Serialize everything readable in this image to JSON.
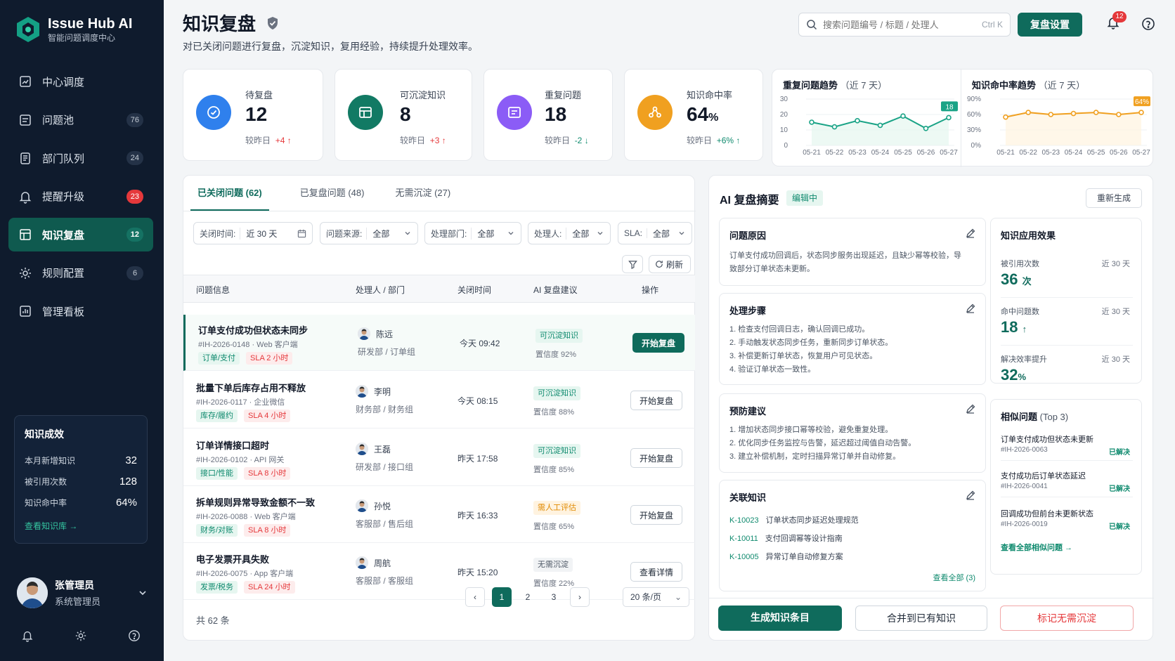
{
  "app": {
    "name": "Issue Hub AI",
    "subtitle": "智能问题调度中心"
  },
  "sidebar": {
    "items": [
      {
        "label": "中心调度",
        "badge": ""
      },
      {
        "label": "问题池",
        "badge": "76"
      },
      {
        "label": "部门队列",
        "badge": "24"
      },
      {
        "label": "提醒升级",
        "badge": "23"
      },
      {
        "label": "知识复盘",
        "badge": "12"
      },
      {
        "label": "规则配置",
        "badge": "6"
      },
      {
        "label": "管理看板",
        "badge": ""
      }
    ],
    "stats": {
      "title": "知识成效",
      "rows": [
        {
          "label": "本月新增知识",
          "value": "32"
        },
        {
          "label": "被引用次数",
          "value": "128"
        },
        {
          "label": "知识命中率",
          "value": "64%"
        }
      ],
      "link": "查看知识库 →"
    },
    "user": {
      "name": "张管理员",
      "role": "系统管理员"
    }
  },
  "header": {
    "title": "知识复盘",
    "desc": "对已关闭问题进行复盘，沉淀知识，复用经验，持续提升处理效率。",
    "search_placeholder": "搜索问题编号 / 标题 / 处理人",
    "search_kbd": "Ctrl K",
    "settings_btn": "复盘设置",
    "notif_count": "12"
  },
  "kpis": [
    {
      "label": "待复盘",
      "value": "12",
      "unit": "",
      "delta_label": "较昨日",
      "delta": "+4 ↑"
    },
    {
      "label": "可沉淀知识",
      "value": "8",
      "unit": "",
      "delta_label": "较昨日",
      "delta": "+3 ↑"
    },
    {
      "label": "重复问题",
      "value": "18",
      "unit": "",
      "delta_label": "较昨日",
      "delta": "-2 ↓"
    },
    {
      "label": "知识命中率",
      "value": "64",
      "unit": "%",
      "delta_label": "较昨日",
      "delta": "+6% ↑"
    }
  ],
  "colors": {
    "primary": "#0f6b5c",
    "sidebar": "#0f1b2d",
    "danger": "#e5383b",
    "teal": "#1aa386",
    "orange": "#f0a020",
    "blue": "#2f80ed",
    "purple": "#8b5cf6"
  },
  "chart_data": [
    {
      "type": "line",
      "title": "重复问题趋势",
      "subtitle": "（近 7 天）",
      "x": [
        "05-21",
        "05-22",
        "05-23",
        "05-24",
        "05-25",
        "05-26",
        "05-27"
      ],
      "series": [
        {
          "values": [
            15,
            12,
            16,
            13,
            19,
            11,
            18
          ]
        }
      ],
      "yticks": [
        "30",
        "20",
        "10",
        "0"
      ],
      "ylim": [
        0,
        30
      ],
      "last_label": "18"
    },
    {
      "type": "line",
      "title": "知识命中率趋势",
      "subtitle": "（近 7 天）",
      "x": [
        "05-21",
        "05-22",
        "05-23",
        "05-24",
        "05-25",
        "05-26",
        "05-27"
      ],
      "series": [
        {
          "values": [
            55,
            64,
            60,
            62,
            64,
            60,
            64
          ]
        }
      ],
      "yticks": [
        "90%",
        "60%",
        "30%",
        "0%"
      ],
      "ylim": [
        0,
        90
      ],
      "last_label": "64%"
    }
  ],
  "table": {
    "tabs": [
      "已关闭问题 (62)",
      "已复盘问题 (48)",
      "无需沉淀 (27)"
    ],
    "filters": [
      {
        "label": "关闭时间:",
        "value": "近 30 天"
      },
      {
        "label": "问题来源:",
        "value": "全部"
      },
      {
        "label": "处理部门:",
        "value": "全部"
      },
      {
        "label": "处理人:",
        "value": "全部"
      },
      {
        "label": "SLA:",
        "value": "全部"
      }
    ],
    "refresh": "刷新",
    "columns": [
      "问题信息",
      "处理人 / 部门",
      "关闭时间",
      "AI 复盘建议",
      "操作"
    ],
    "rows": [
      {
        "title": "订单支付成功但状态未同步",
        "sub": "#IH-2026-0148 · Web 客户端",
        "tag1": "订单/支付",
        "tag2": "SLA 2 小时",
        "person": "陈远",
        "dept": "研发部 / 订单组",
        "time": "今天 09:42",
        "sug": "可沉淀知识",
        "conf": "置信度 92%",
        "action": "开始复盘"
      },
      {
        "title": "批量下单后库存占用不释放",
        "sub": "#IH-2026-0117 · 企业微信",
        "tag1": "库存/履约",
        "tag2": "SLA 4 小时",
        "person": "李明",
        "dept": "财务部 / 财务组",
        "time": "今天 08:15",
        "sug": "可沉淀知识",
        "conf": "置信度 88%",
        "action": "开始复盘"
      },
      {
        "title": "订单详情接口超时",
        "sub": "#IH-2026-0102 · API 网关",
        "tag1": "接口/性能",
        "tag2": "SLA 8 小时",
        "person": "王磊",
        "dept": "研发部 / 接口组",
        "time": "昨天 17:58",
        "sug": "可沉淀知识",
        "conf": "置信度 85%",
        "action": "开始复盘"
      },
      {
        "title": "拆单规则异常导致金额不一致",
        "sub": "#IH-2026-0088 · Web 客户端",
        "tag1": "财务/对账",
        "tag2": "SLA 8 小时",
        "person": "孙悦",
        "dept": "客服部 / 售后组",
        "time": "昨天 16:33",
        "sug": "需人工评估",
        "conf": "置信度 65%",
        "action": "开始复盘"
      },
      {
        "title": "电子发票开具失败",
        "sub": "#IH-2026-0075 · App 客户端",
        "tag1": "发票/税务",
        "tag2": "SLA 24 小时",
        "person": "周航",
        "dept": "客服部 / 客服组",
        "time": "昨天 15:20",
        "sug": "无需沉淀",
        "conf": "置信度 22%",
        "action": "查看详情"
      }
    ],
    "total": "共 62 条",
    "pages": [
      "1",
      "2",
      "3"
    ],
    "page_size": "20 条/页"
  },
  "ai": {
    "title": "AI 复盘摘要",
    "status": "编辑中",
    "regen": "重新生成",
    "cause": {
      "title": "问题原因",
      "text": [
        "订单支付成功回调后，状态同步服务出现延迟，且缺少幂等校验，导",
        "致部分订单状态未更新。"
      ]
    },
    "steps": {
      "title": "处理步骤",
      "items": [
        "1.  检查支付回调日志，确认回调已成功。",
        "2.  手动触发状态同步任务，重新同步订单状态。",
        "3.  补偿更新订单状态，恢复用户可见状态。",
        "4.  验证订单状态一致性。"
      ]
    },
    "prevent": {
      "title": "预防建议",
      "items": [
        "1.  增加状态同步接口幂等校验，避免重复处理。",
        "2.  优化同步任务监控与告警，延迟超过阈值自动告警。",
        "3.  建立补偿机制，定时扫描异常订单并自动修复。"
      ]
    },
    "related": {
      "title": "关联知识",
      "items": [
        {
          "id": "K-10023",
          "name": "订单状态同步延迟处理规范"
        },
        {
          "id": "K-10011",
          "name": "支付回调幂等设计指南"
        },
        {
          "id": "K-10005",
          "name": "异常订单自动修复方案"
        }
      ],
      "link": "查看全部 (3)"
    },
    "effect": {
      "title": "知识应用效果",
      "metrics": [
        {
          "label": "被引用次数",
          "period": "近 30 天",
          "value": "36",
          "unit": "次"
        },
        {
          "label": "命中问题数",
          "period": "近 30 天",
          "value": "18",
          "unit": "↑"
        },
        {
          "label": "解决效率提升",
          "period": "近 30 天",
          "value": "32",
          "unit": "%"
        }
      ]
    },
    "similar": {
      "title": "相似问题",
      "count": "(Top 3)",
      "items": [
        {
          "title": "订单支付成功但状态未更新",
          "id": "#IH-2026-0063",
          "status": "已解决"
        },
        {
          "title": "支付成功后订单状态延迟",
          "id": "#IH-2026-0041",
          "status": "已解决"
        },
        {
          "title": "回调成功但前台未更新状态",
          "id": "#IH-2026-0019",
          "status": "已解决"
        }
      ],
      "link": "查看全部相似问题 →"
    },
    "buttons": {
      "generate": "生成知识条目",
      "merge": "合并到已有知识",
      "mark": "标记无需沉淀"
    }
  }
}
